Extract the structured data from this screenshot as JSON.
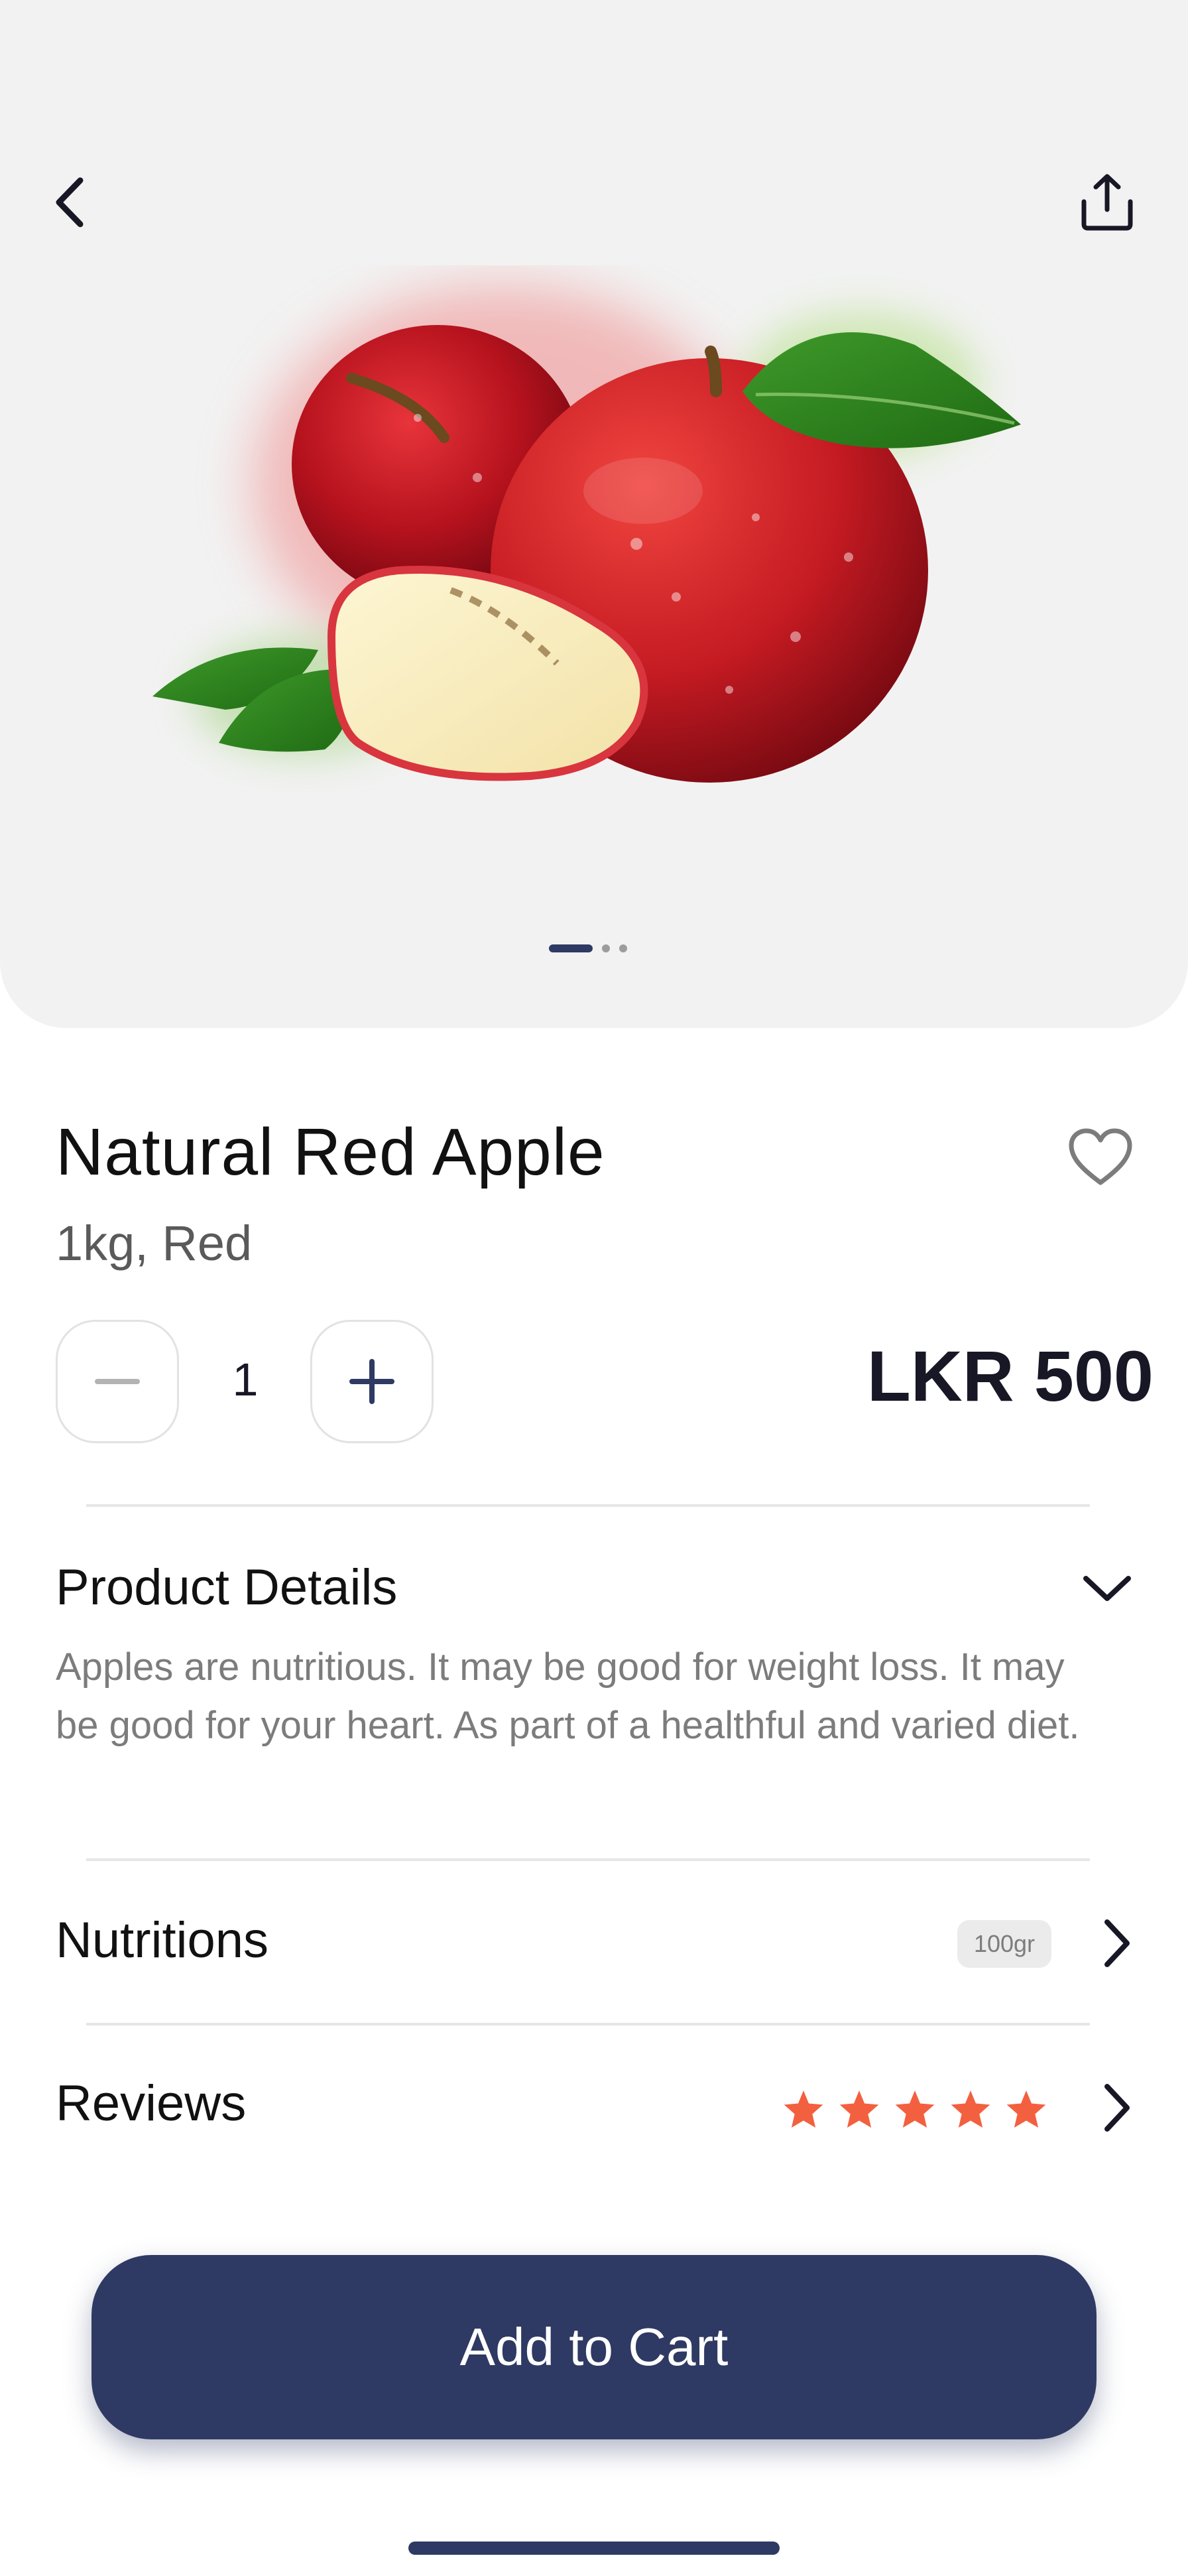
{
  "product": {
    "title": "Natural Red Apple",
    "subtitle": "1kg, Red",
    "quantity": "1",
    "price": "LKR 500",
    "gallery_slides": 3,
    "active_slide": 1
  },
  "details": {
    "title": "Product Details",
    "description": "Apples are nutritious. It may be good for weight loss. It may be good for your heart. As part of a healthful and varied diet."
  },
  "nutritions": {
    "title": "Nutritions",
    "badge": "100gr"
  },
  "reviews": {
    "title": "Reviews",
    "rating": 5,
    "max_rating": 5
  },
  "cta": {
    "label": "Add to Cart"
  },
  "colors": {
    "primary": "#2e3a63",
    "star": "#f3603f",
    "hero_bg": "#f2f2f2"
  },
  "icons": [
    "back-icon",
    "share-icon",
    "heart-icon",
    "minus-icon",
    "plus-icon",
    "chevron-down-icon",
    "chevron-right-icon",
    "star-icon"
  ]
}
